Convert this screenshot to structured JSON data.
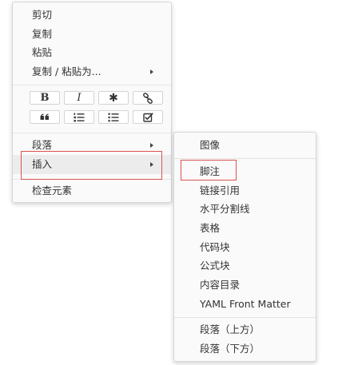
{
  "context_menu": {
    "cut": "剪切",
    "copy": "复制",
    "paste": "粘贴",
    "copy_paste_as": "复制 / 粘贴为...",
    "format_buttons": {
      "bold": "B",
      "italic": "I",
      "code": "✱"
    },
    "paragraph": "段落",
    "insert": "插入",
    "inspect": "检查元素"
  },
  "insert_submenu": {
    "image": "图像",
    "footnote": "脚注",
    "link_reference": "链接引用",
    "horizontal_rule": "水平分割线",
    "table": "表格",
    "code_block": "代码块",
    "math_block": "公式块",
    "toc": "内容目录",
    "yaml_front_matter": "YAML Front Matter",
    "paragraph_above": "段落（上方）",
    "paragraph_below": "段落（下方）"
  },
  "colors": {
    "highlight_border": "#d9534f",
    "hover_background": "#ececec",
    "menu_background": "#fafafa"
  },
  "icons": {
    "link": "link-icon",
    "quote": "quote-icon",
    "ordered_list": "ordered-list-icon",
    "unordered_list": "unordered-list-icon",
    "task_list": "task-list-icon",
    "submenu_arrow": "chevron-right-icon"
  }
}
